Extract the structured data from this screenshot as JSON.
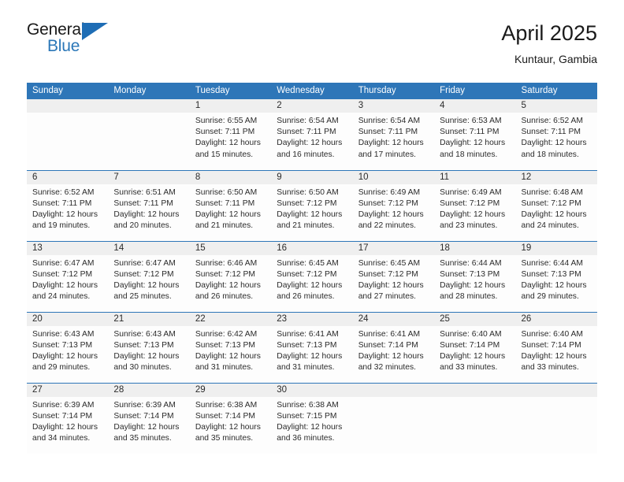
{
  "brand": {
    "name_part1": "General",
    "name_part2": "Blue",
    "triangle_icon": "brand-triangle-icon",
    "accent_color": "#2b77b8"
  },
  "header": {
    "title": "April 2025",
    "subtitle": "Kuntaur, Gambia"
  },
  "theme": {
    "header_blue": "#2e76b8",
    "date_strip_gray": "#efefef",
    "cell_bg": "#fdfdfd",
    "text": "#2b2b2b"
  },
  "weekdays": [
    "Sunday",
    "Monday",
    "Tuesday",
    "Wednesday",
    "Thursday",
    "Friday",
    "Saturday"
  ],
  "weeks": [
    [
      {
        "day": ""
      },
      {
        "day": ""
      },
      {
        "day": "1",
        "sunrise": "Sunrise: 6:55 AM",
        "sunset": "Sunset: 7:11 PM",
        "daylight1": "Daylight: 12 hours",
        "daylight2": "and 15 minutes."
      },
      {
        "day": "2",
        "sunrise": "Sunrise: 6:54 AM",
        "sunset": "Sunset: 7:11 PM",
        "daylight1": "Daylight: 12 hours",
        "daylight2": "and 16 minutes."
      },
      {
        "day": "3",
        "sunrise": "Sunrise: 6:54 AM",
        "sunset": "Sunset: 7:11 PM",
        "daylight1": "Daylight: 12 hours",
        "daylight2": "and 17 minutes."
      },
      {
        "day": "4",
        "sunrise": "Sunrise: 6:53 AM",
        "sunset": "Sunset: 7:11 PM",
        "daylight1": "Daylight: 12 hours",
        "daylight2": "and 18 minutes."
      },
      {
        "day": "5",
        "sunrise": "Sunrise: 6:52 AM",
        "sunset": "Sunset: 7:11 PM",
        "daylight1": "Daylight: 12 hours",
        "daylight2": "and 18 minutes."
      }
    ],
    [
      {
        "day": "6",
        "sunrise": "Sunrise: 6:52 AM",
        "sunset": "Sunset: 7:11 PM",
        "daylight1": "Daylight: 12 hours",
        "daylight2": "and 19 minutes."
      },
      {
        "day": "7",
        "sunrise": "Sunrise: 6:51 AM",
        "sunset": "Sunset: 7:11 PM",
        "daylight1": "Daylight: 12 hours",
        "daylight2": "and 20 minutes."
      },
      {
        "day": "8",
        "sunrise": "Sunrise: 6:50 AM",
        "sunset": "Sunset: 7:11 PM",
        "daylight1": "Daylight: 12 hours",
        "daylight2": "and 21 minutes."
      },
      {
        "day": "9",
        "sunrise": "Sunrise: 6:50 AM",
        "sunset": "Sunset: 7:12 PM",
        "daylight1": "Daylight: 12 hours",
        "daylight2": "and 21 minutes."
      },
      {
        "day": "10",
        "sunrise": "Sunrise: 6:49 AM",
        "sunset": "Sunset: 7:12 PM",
        "daylight1": "Daylight: 12 hours",
        "daylight2": "and 22 minutes."
      },
      {
        "day": "11",
        "sunrise": "Sunrise: 6:49 AM",
        "sunset": "Sunset: 7:12 PM",
        "daylight1": "Daylight: 12 hours",
        "daylight2": "and 23 minutes."
      },
      {
        "day": "12",
        "sunrise": "Sunrise: 6:48 AM",
        "sunset": "Sunset: 7:12 PM",
        "daylight1": "Daylight: 12 hours",
        "daylight2": "and 24 minutes."
      }
    ],
    [
      {
        "day": "13",
        "sunrise": "Sunrise: 6:47 AM",
        "sunset": "Sunset: 7:12 PM",
        "daylight1": "Daylight: 12 hours",
        "daylight2": "and 24 minutes."
      },
      {
        "day": "14",
        "sunrise": "Sunrise: 6:47 AM",
        "sunset": "Sunset: 7:12 PM",
        "daylight1": "Daylight: 12 hours",
        "daylight2": "and 25 minutes."
      },
      {
        "day": "15",
        "sunrise": "Sunrise: 6:46 AM",
        "sunset": "Sunset: 7:12 PM",
        "daylight1": "Daylight: 12 hours",
        "daylight2": "and 26 minutes."
      },
      {
        "day": "16",
        "sunrise": "Sunrise: 6:45 AM",
        "sunset": "Sunset: 7:12 PM",
        "daylight1": "Daylight: 12 hours",
        "daylight2": "and 26 minutes."
      },
      {
        "day": "17",
        "sunrise": "Sunrise: 6:45 AM",
        "sunset": "Sunset: 7:12 PM",
        "daylight1": "Daylight: 12 hours",
        "daylight2": "and 27 minutes."
      },
      {
        "day": "18",
        "sunrise": "Sunrise: 6:44 AM",
        "sunset": "Sunset: 7:13 PM",
        "daylight1": "Daylight: 12 hours",
        "daylight2": "and 28 minutes."
      },
      {
        "day": "19",
        "sunrise": "Sunrise: 6:44 AM",
        "sunset": "Sunset: 7:13 PM",
        "daylight1": "Daylight: 12 hours",
        "daylight2": "and 29 minutes."
      }
    ],
    [
      {
        "day": "20",
        "sunrise": "Sunrise: 6:43 AM",
        "sunset": "Sunset: 7:13 PM",
        "daylight1": "Daylight: 12 hours",
        "daylight2": "and 29 minutes."
      },
      {
        "day": "21",
        "sunrise": "Sunrise: 6:43 AM",
        "sunset": "Sunset: 7:13 PM",
        "daylight1": "Daylight: 12 hours",
        "daylight2": "and 30 minutes."
      },
      {
        "day": "22",
        "sunrise": "Sunrise: 6:42 AM",
        "sunset": "Sunset: 7:13 PM",
        "daylight1": "Daylight: 12 hours",
        "daylight2": "and 31 minutes."
      },
      {
        "day": "23",
        "sunrise": "Sunrise: 6:41 AM",
        "sunset": "Sunset: 7:13 PM",
        "daylight1": "Daylight: 12 hours",
        "daylight2": "and 31 minutes."
      },
      {
        "day": "24",
        "sunrise": "Sunrise: 6:41 AM",
        "sunset": "Sunset: 7:14 PM",
        "daylight1": "Daylight: 12 hours",
        "daylight2": "and 32 minutes."
      },
      {
        "day": "25",
        "sunrise": "Sunrise: 6:40 AM",
        "sunset": "Sunset: 7:14 PM",
        "daylight1": "Daylight: 12 hours",
        "daylight2": "and 33 minutes."
      },
      {
        "day": "26",
        "sunrise": "Sunrise: 6:40 AM",
        "sunset": "Sunset: 7:14 PM",
        "daylight1": "Daylight: 12 hours",
        "daylight2": "and 33 minutes."
      }
    ],
    [
      {
        "day": "27",
        "sunrise": "Sunrise: 6:39 AM",
        "sunset": "Sunset: 7:14 PM",
        "daylight1": "Daylight: 12 hours",
        "daylight2": "and 34 minutes."
      },
      {
        "day": "28",
        "sunrise": "Sunrise: 6:39 AM",
        "sunset": "Sunset: 7:14 PM",
        "daylight1": "Daylight: 12 hours",
        "daylight2": "and 35 minutes."
      },
      {
        "day": "29",
        "sunrise": "Sunrise: 6:38 AM",
        "sunset": "Sunset: 7:14 PM",
        "daylight1": "Daylight: 12 hours",
        "daylight2": "and 35 minutes."
      },
      {
        "day": "30",
        "sunrise": "Sunrise: 6:38 AM",
        "sunset": "Sunset: 7:15 PM",
        "daylight1": "Daylight: 12 hours",
        "daylight2": "and 36 minutes."
      },
      {
        "day": ""
      },
      {
        "day": ""
      },
      {
        "day": ""
      }
    ]
  ]
}
